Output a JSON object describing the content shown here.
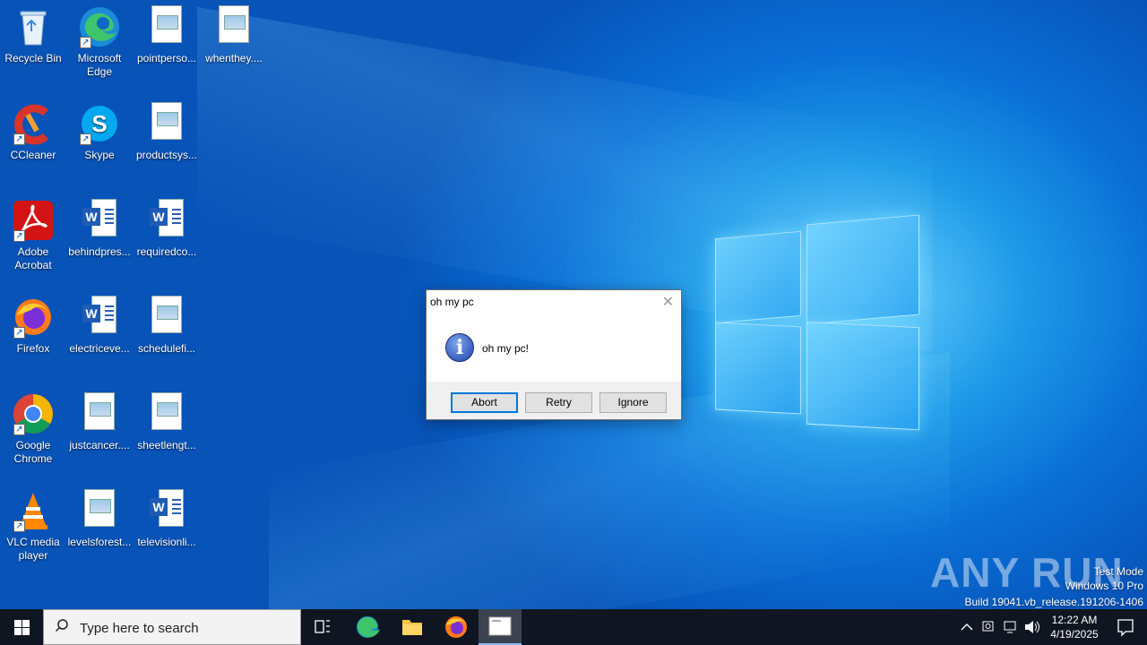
{
  "desktop_icons": [
    {
      "label": "Recycle Bin",
      "type": "recycle",
      "shortcut": false
    },
    {
      "label": "Microsoft Edge",
      "type": "edge",
      "shortcut": true
    },
    {
      "label": "pointperso...",
      "type": "doc",
      "shortcut": false
    },
    {
      "label": "whenthey....",
      "type": "doc",
      "shortcut": false
    },
    {
      "label": "CCleaner",
      "type": "ccleaner",
      "shortcut": true
    },
    {
      "label": "Skype",
      "type": "skype",
      "shortcut": true
    },
    {
      "label": "productsys...",
      "type": "doc",
      "shortcut": false
    },
    {
      "label": "Adobe Acrobat",
      "type": "acrobat",
      "shortcut": true
    },
    {
      "label": "behindpres...",
      "type": "word",
      "shortcut": false
    },
    {
      "label": "requiredco...",
      "type": "word",
      "shortcut": false
    },
    {
      "label": "Firefox",
      "type": "firefox",
      "shortcut": true
    },
    {
      "label": "electriceve...",
      "type": "word",
      "shortcut": false
    },
    {
      "label": "schedulefi...",
      "type": "doc",
      "shortcut": false
    },
    {
      "label": "Google Chrome",
      "type": "chrome",
      "shortcut": true
    },
    {
      "label": "justcancer....",
      "type": "doc",
      "shortcut": false
    },
    {
      "label": "sheetlengt...",
      "type": "doc",
      "shortcut": false
    },
    {
      "label": "VLC media player",
      "type": "vlc",
      "shortcut": true
    },
    {
      "label": "levelsforest...",
      "type": "doc",
      "shortcut": false
    },
    {
      "label": "televisionli...",
      "type": "word",
      "shortcut": false
    }
  ],
  "dialog": {
    "title": "oh my pc",
    "message": "oh my pc!",
    "icon": "info-icon",
    "buttons": {
      "abort": "Abort",
      "retry": "Retry",
      "ignore": "Ignore"
    }
  },
  "watermark": {
    "brand": "ANY RUN",
    "line1": "Test Mode",
    "line2": "Windows 10 Pro",
    "line3": "Build 19041.vb_release.191206-1406"
  },
  "taskbar": {
    "search_placeholder": "Type here to search",
    "time": "12:22 AM",
    "date": "4/19/2025",
    "pinned": [
      "task-view-icon",
      "edge-icon",
      "file-explorer-icon",
      "firefox-icon",
      "active-window-icon"
    ]
  }
}
